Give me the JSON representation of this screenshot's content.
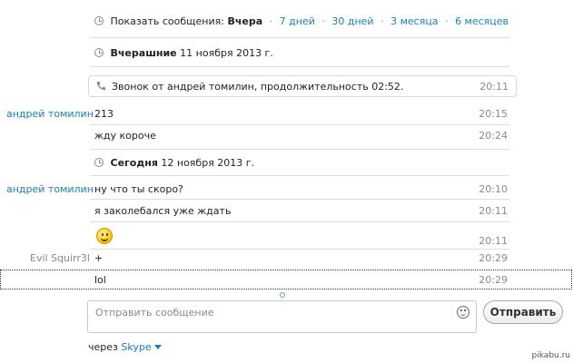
{
  "filter_bar": {
    "label": "Показать сообщения:",
    "active": "Вчера",
    "options": [
      "7 дней",
      "30 дней",
      "3 месяца",
      "6 месяцев"
    ]
  },
  "day_headers": [
    {
      "day": "Вчерашние",
      "date": "11 ноября 2013 г."
    },
    {
      "day": "Сегодня",
      "date": "12 ноября 2013 г."
    }
  ],
  "call": {
    "text": "Звонок от андрей томилин, продолжительность 02:52.",
    "time": "20:11"
  },
  "messages": [
    {
      "sender": "андрей томилин",
      "text": "213",
      "time": "20:15"
    },
    {
      "sender": "",
      "text": "жду короче",
      "time": "20:24"
    },
    {
      "sender": "андрей томилин",
      "text": "ну что ты скоро?",
      "time": "20:10"
    },
    {
      "sender": "",
      "text": "я заколебался уже ждать",
      "time": "20:11"
    },
    {
      "sender": "",
      "text": "",
      "emoticon": "smile-icon",
      "time": "20:11"
    },
    {
      "sender": "Evil Squirr3l",
      "text": "+",
      "time": "20:29"
    },
    {
      "sender": "",
      "text": "lol",
      "time": "20:29"
    }
  ],
  "composer": {
    "placeholder": "Отправить сообщение",
    "send_label": "Отправить",
    "via_label": "через",
    "via_service": "Skype"
  },
  "watermark": "pikabu.ru",
  "colors": {
    "accent": "#1a7fb8",
    "muted": "#8a8a8a"
  }
}
